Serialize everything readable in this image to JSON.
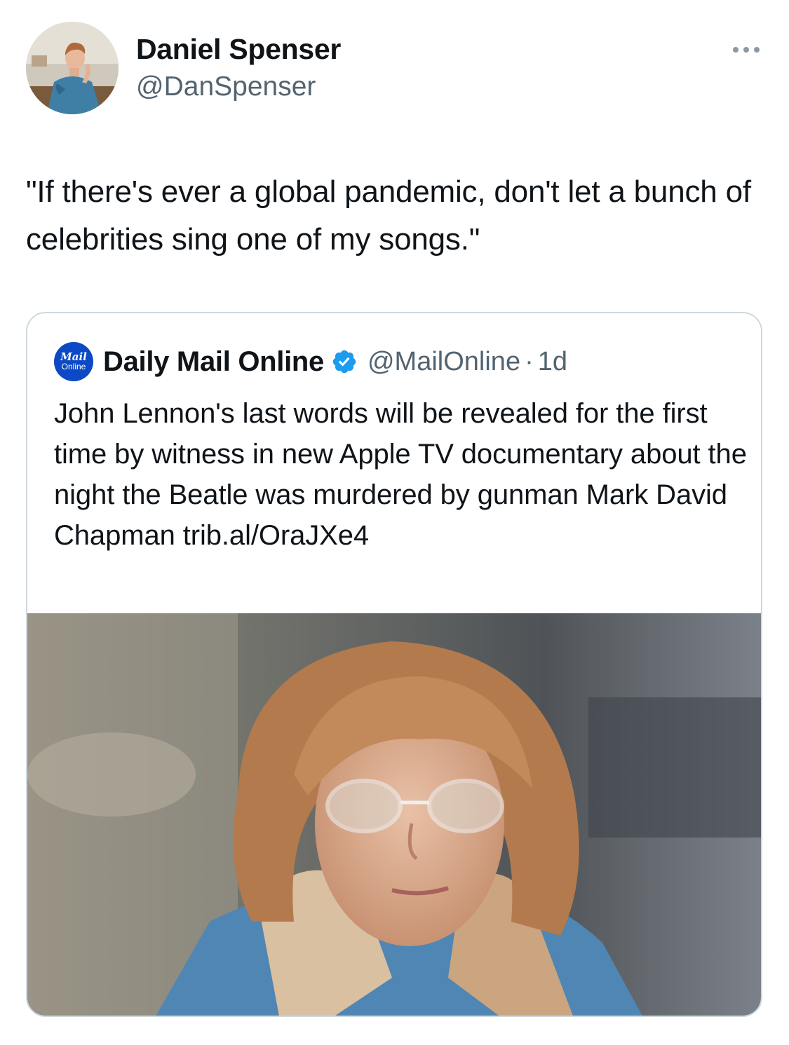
{
  "author": {
    "display_name": "Daniel Spenser",
    "handle": "@DanSpenser",
    "avatar_icon": "profile-photo"
  },
  "tweet": {
    "text": "\"If there's ever a global pandemic, don't let a bunch of celebrities sing one of my songs.\""
  },
  "more_icon": "ellipsis-icon",
  "quoted_tweet": {
    "logo_line1": "Mail",
    "logo_line2": "Online",
    "display_name": "Daily Mail Online",
    "verified_icon": "verified-badge-icon",
    "handle": "@MailOnline",
    "separator": "·",
    "time": "1d",
    "text": "John Lennon's last words will be revealed for the first time by witness in new Apple TV documentary about the night the Beatle was murdered by gunman Mark David Chapman trib.al/OraJXe4",
    "photo": "portrait-photo"
  },
  "colors": {
    "text": "#0f1419",
    "secondary_text": "#536471",
    "verified_blue": "#1d9bf0",
    "mail_logo_blue": "#0d49c5",
    "border": "#cfd9de"
  }
}
